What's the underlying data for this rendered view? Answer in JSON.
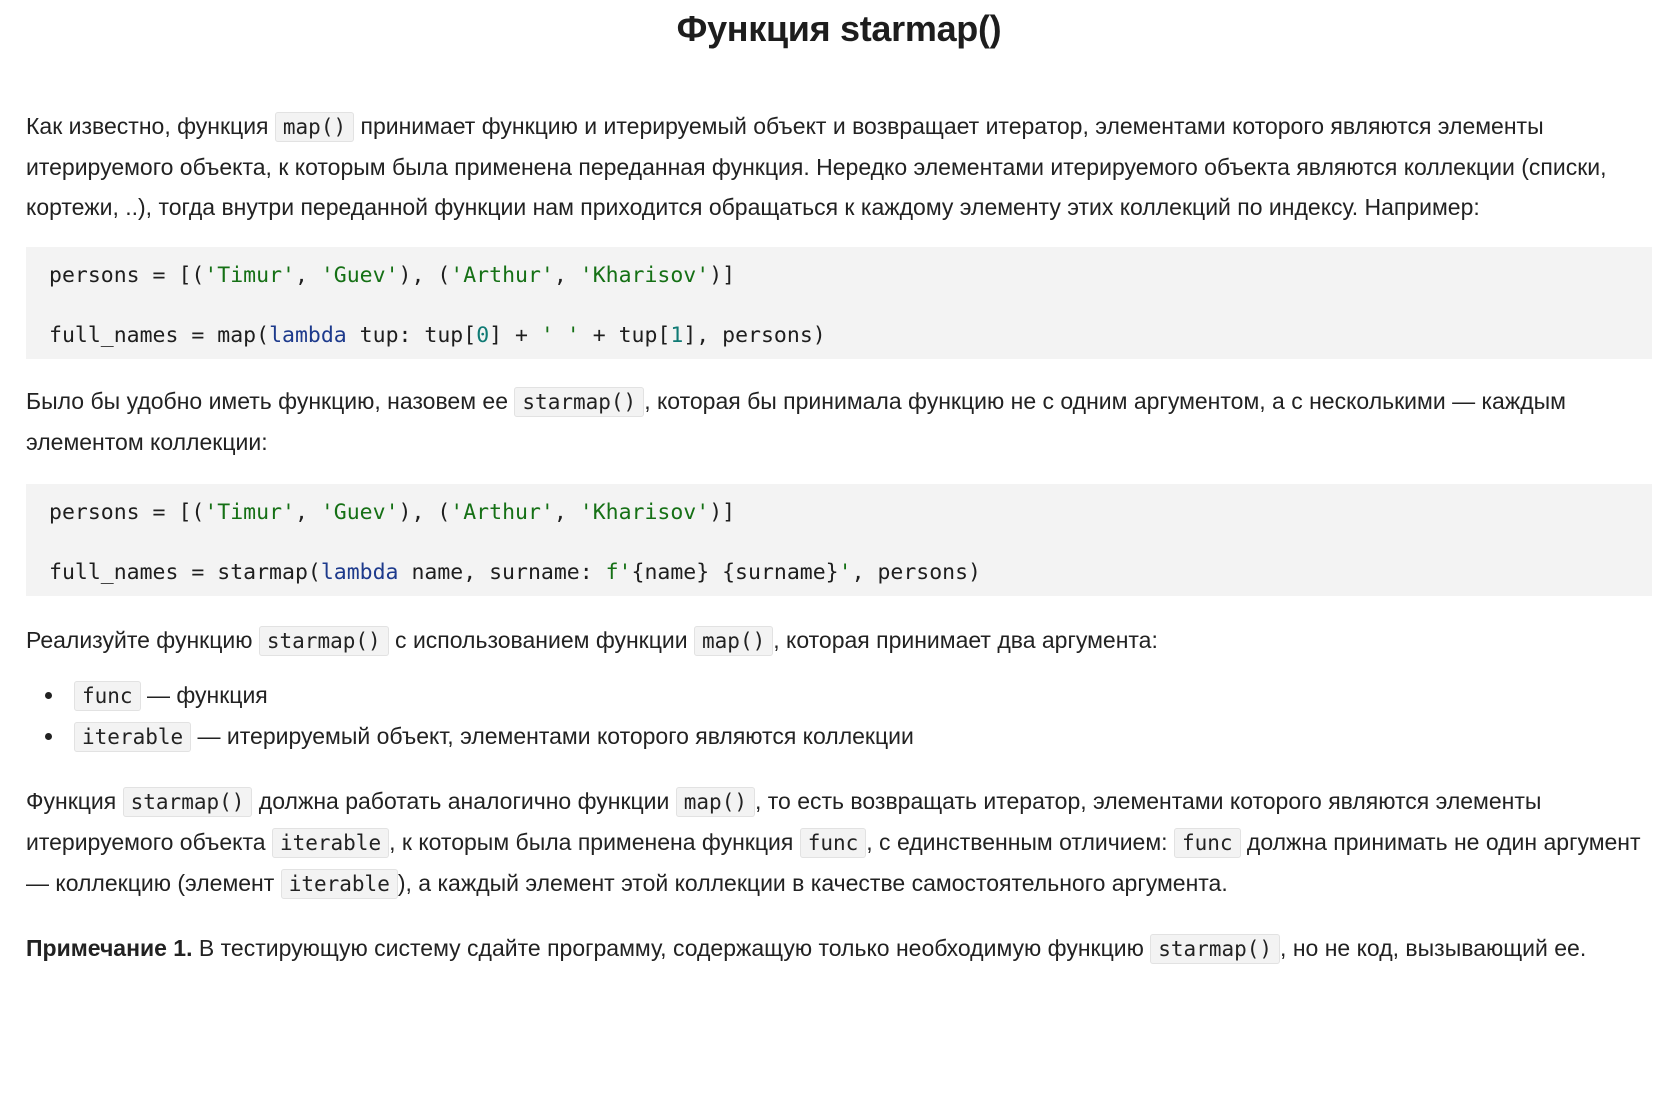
{
  "title": "Функция starmap()",
  "para1": {
    "t1": "Как известно, функция ",
    "c1": "map()",
    "t2": " принимает функцию и итерируемый объект и возвращает итератор, элементами которого являются элементы итерируемого объекта, к которым была применена переданная функция. Нередко элементами итерируемого объекта являются коллекции (списки, кортежи, ..), тогда внутри переданной функции нам приходится обращаться к каждому элементу этих коллекций по индексу. Например:"
  },
  "code1": {
    "line1": {
      "a": "persons = [(",
      "s1": "'Timur'",
      "b": ", ",
      "s2": "'Guev'",
      "c": "), (",
      "s3": "'Arthur'",
      "d": ", ",
      "s4": "'Kharisov'",
      "e": ")]"
    },
    "line2": {
      "a": "full_names = map(",
      "kw": "lambda",
      "b": " tup: tup[",
      "n0": "0",
      "c": "] + ",
      "s1": "' '",
      "d": " + tup[",
      "n1": "1",
      "e": "], persons)"
    }
  },
  "para2": {
    "t1": "Было бы удобно иметь функцию, назовем ее ",
    "c1": "starmap()",
    "t2": ", которая бы принимала функцию не с одним аргументом, а с несколькими — каждым элементом коллекции:"
  },
  "code2": {
    "line1": {
      "a": "persons = [(",
      "s1": "'Timur'",
      "b": ", ",
      "s2": "'Guev'",
      "c": "), (",
      "s3": "'Arthur'",
      "d": ", ",
      "s4": "'Kharisov'",
      "e": ")]"
    },
    "line2": {
      "a": "full_names = starmap(",
      "kw": "lambda",
      "b": " name, surname: ",
      "s1": "f'",
      "c": "{name} {surname}",
      "s2": "'",
      "d": ", persons)"
    }
  },
  "para3": {
    "t1": "Реализуйте функцию ",
    "c1": "starmap()",
    "t2": " с использованием функции ",
    "c2": "map()",
    "t3": ", которая принимает два аргумента:"
  },
  "bullets": [
    {
      "code": "func",
      "text": " — функция"
    },
    {
      "code": "iterable",
      "text": " — итерируемый объект, элементами которого являются коллекции"
    }
  ],
  "para4": {
    "t1": "Функция ",
    "c1": "starmap()",
    "t2": " должна работать аналогично функции ",
    "c2": "map()",
    "t3": ", то есть возвращать итератор, элементами которого являются элементы итерируемого объекта ",
    "c3": "iterable",
    "t4": ", к которым была применена функция ",
    "c4": "func",
    "t5": ", с единственным отличием: ",
    "c5": "func",
    "t6": " должна принимать не один аргумент — коллекцию (элемент ",
    "c6": "iterable",
    "t7": "), а каждый элемент этой коллекции в качестве самостоятельного аргумента."
  },
  "note": {
    "bold": "Примечание 1.",
    "t1": " В тестирующую систему сдайте программу, содержащую только необходимую функцию ",
    "c1": "starmap()",
    "t2": ", но не код, вызывающий ее."
  }
}
